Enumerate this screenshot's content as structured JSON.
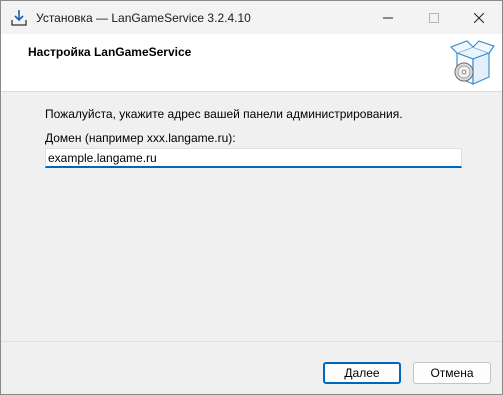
{
  "window": {
    "title": "Установка — LanGameService 3.2.4.10"
  },
  "header": {
    "title": "Настройка LanGameService"
  },
  "content": {
    "prompt": "Пожалуйста, укажите адрес вашей панели администрирования.",
    "domain_label": "Домен (например xxx.langame.ru):",
    "domain_value": "example.langame.ru"
  },
  "buttons": {
    "next": "Далее",
    "cancel": "Отмена"
  },
  "colors": {
    "accent": "#0067c0",
    "background": "#f0f0f0"
  }
}
